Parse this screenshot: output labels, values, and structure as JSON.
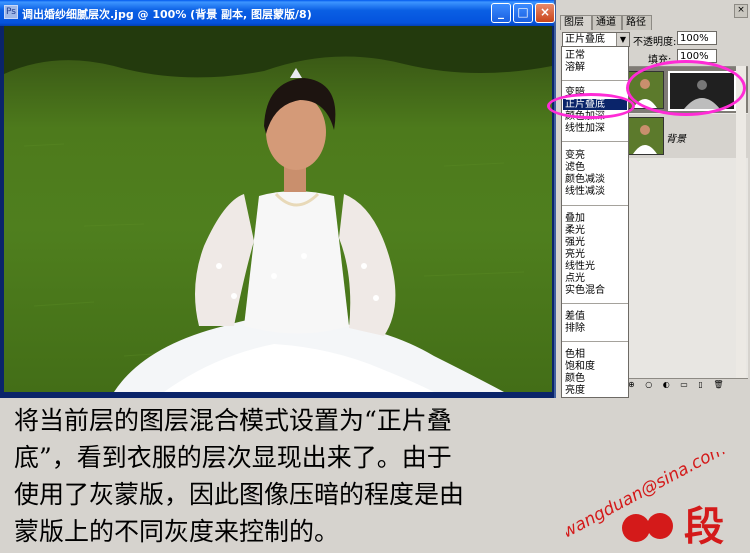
{
  "document": {
    "title": "调出婚纱细腻层次.jpg @ 100% (背景 副本, 图层蒙版/8)",
    "icon": "photoshop-doc-icon",
    "buttons": {
      "minimize": "_",
      "maximize": "□",
      "close": "×"
    }
  },
  "layers_panel": {
    "tabs": [
      "图层",
      "通道",
      "路径"
    ],
    "close_glyph": "×",
    "blend_mode": "正片叠底",
    "opacity_label": "不透明度:",
    "opacity_value": "100%",
    "fill_label": "填充:",
    "fill_value": "100%",
    "layers": [
      {
        "name": "",
        "has_mask": true
      },
      {
        "name": "背景",
        "locked": true
      }
    ],
    "toolbar_icons": "⊕ ○ ◐ ▭ ▯ 🗑"
  },
  "blend_modes": {
    "group1": [
      "正常",
      "溶解"
    ],
    "group2": [
      "变暗",
      "正片叠底",
      "颜色加深",
      "线性加深"
    ],
    "group3": [
      "变亮",
      "滤色",
      "颜色减淡",
      "线性减淡"
    ],
    "group4": [
      "叠加",
      "柔光",
      "强光",
      "亮光",
      "线性光",
      "点光",
      "实色混合"
    ],
    "group5": [
      "差值",
      "排除"
    ],
    "group6": [
      "色相",
      "饱和度",
      "颜色",
      "亮度"
    ],
    "selected": "正片叠底"
  },
  "caption": {
    "line1": "将当前层的图层混合模式设置为“正片叠",
    "line2": "底”，看到衣服的层次显现出来了。由于",
    "line3": "使用了灰蒙版，因此图像压暗的程度是由",
    "line4": "蒙版上的不同灰度来控制的。"
  },
  "watermark": {
    "email": "wangduan@sina.com",
    "signature": "段"
  },
  "colors": {
    "titlebar": "#0453dd",
    "highlight": "#ff2bd6",
    "selection": "#0a246a"
  }
}
